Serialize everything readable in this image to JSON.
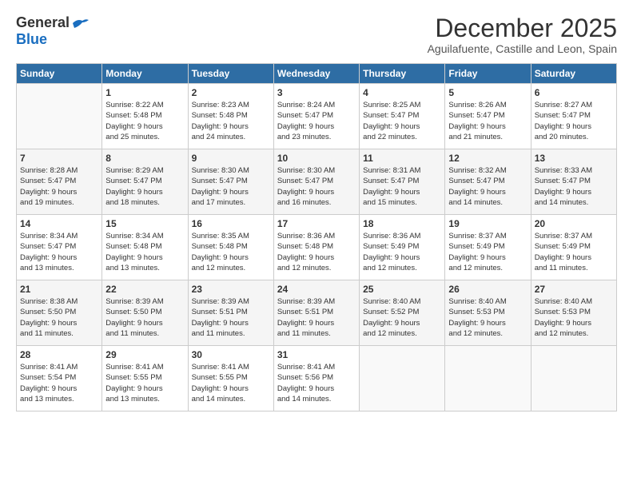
{
  "logo": {
    "general": "General",
    "blue": "Blue"
  },
  "title": "December 2025",
  "subtitle": "Aguilafuente, Castille and Leon, Spain",
  "weekdays": [
    "Sunday",
    "Monday",
    "Tuesday",
    "Wednesday",
    "Thursday",
    "Friday",
    "Saturday"
  ],
  "weeks": [
    [
      {
        "day": "",
        "info": ""
      },
      {
        "day": "1",
        "info": "Sunrise: 8:22 AM\nSunset: 5:48 PM\nDaylight: 9 hours\nand 25 minutes."
      },
      {
        "day": "2",
        "info": "Sunrise: 8:23 AM\nSunset: 5:48 PM\nDaylight: 9 hours\nand 24 minutes."
      },
      {
        "day": "3",
        "info": "Sunrise: 8:24 AM\nSunset: 5:47 PM\nDaylight: 9 hours\nand 23 minutes."
      },
      {
        "day": "4",
        "info": "Sunrise: 8:25 AM\nSunset: 5:47 PM\nDaylight: 9 hours\nand 22 minutes."
      },
      {
        "day": "5",
        "info": "Sunrise: 8:26 AM\nSunset: 5:47 PM\nDaylight: 9 hours\nand 21 minutes."
      },
      {
        "day": "6",
        "info": "Sunrise: 8:27 AM\nSunset: 5:47 PM\nDaylight: 9 hours\nand 20 minutes."
      }
    ],
    [
      {
        "day": "7",
        "info": "Sunrise: 8:28 AM\nSunset: 5:47 PM\nDaylight: 9 hours\nand 19 minutes."
      },
      {
        "day": "8",
        "info": "Sunrise: 8:29 AM\nSunset: 5:47 PM\nDaylight: 9 hours\nand 18 minutes."
      },
      {
        "day": "9",
        "info": "Sunrise: 8:30 AM\nSunset: 5:47 PM\nDaylight: 9 hours\nand 17 minutes."
      },
      {
        "day": "10",
        "info": "Sunrise: 8:30 AM\nSunset: 5:47 PM\nDaylight: 9 hours\nand 16 minutes."
      },
      {
        "day": "11",
        "info": "Sunrise: 8:31 AM\nSunset: 5:47 PM\nDaylight: 9 hours\nand 15 minutes."
      },
      {
        "day": "12",
        "info": "Sunrise: 8:32 AM\nSunset: 5:47 PM\nDaylight: 9 hours\nand 14 minutes."
      },
      {
        "day": "13",
        "info": "Sunrise: 8:33 AM\nSunset: 5:47 PM\nDaylight: 9 hours\nand 14 minutes."
      }
    ],
    [
      {
        "day": "14",
        "info": "Sunrise: 8:34 AM\nSunset: 5:47 PM\nDaylight: 9 hours\nand 13 minutes."
      },
      {
        "day": "15",
        "info": "Sunrise: 8:34 AM\nSunset: 5:48 PM\nDaylight: 9 hours\nand 13 minutes."
      },
      {
        "day": "16",
        "info": "Sunrise: 8:35 AM\nSunset: 5:48 PM\nDaylight: 9 hours\nand 12 minutes."
      },
      {
        "day": "17",
        "info": "Sunrise: 8:36 AM\nSunset: 5:48 PM\nDaylight: 9 hours\nand 12 minutes."
      },
      {
        "day": "18",
        "info": "Sunrise: 8:36 AM\nSunset: 5:49 PM\nDaylight: 9 hours\nand 12 minutes."
      },
      {
        "day": "19",
        "info": "Sunrise: 8:37 AM\nSunset: 5:49 PM\nDaylight: 9 hours\nand 12 minutes."
      },
      {
        "day": "20",
        "info": "Sunrise: 8:37 AM\nSunset: 5:49 PM\nDaylight: 9 hours\nand 11 minutes."
      }
    ],
    [
      {
        "day": "21",
        "info": "Sunrise: 8:38 AM\nSunset: 5:50 PM\nDaylight: 9 hours\nand 11 minutes."
      },
      {
        "day": "22",
        "info": "Sunrise: 8:39 AM\nSunset: 5:50 PM\nDaylight: 9 hours\nand 11 minutes."
      },
      {
        "day": "23",
        "info": "Sunrise: 8:39 AM\nSunset: 5:51 PM\nDaylight: 9 hours\nand 11 minutes."
      },
      {
        "day": "24",
        "info": "Sunrise: 8:39 AM\nSunset: 5:51 PM\nDaylight: 9 hours\nand 11 minutes."
      },
      {
        "day": "25",
        "info": "Sunrise: 8:40 AM\nSunset: 5:52 PM\nDaylight: 9 hours\nand 12 minutes."
      },
      {
        "day": "26",
        "info": "Sunrise: 8:40 AM\nSunset: 5:53 PM\nDaylight: 9 hours\nand 12 minutes."
      },
      {
        "day": "27",
        "info": "Sunrise: 8:40 AM\nSunset: 5:53 PM\nDaylight: 9 hours\nand 12 minutes."
      }
    ],
    [
      {
        "day": "28",
        "info": "Sunrise: 8:41 AM\nSunset: 5:54 PM\nDaylight: 9 hours\nand 13 minutes."
      },
      {
        "day": "29",
        "info": "Sunrise: 8:41 AM\nSunset: 5:55 PM\nDaylight: 9 hours\nand 13 minutes."
      },
      {
        "day": "30",
        "info": "Sunrise: 8:41 AM\nSunset: 5:55 PM\nDaylight: 9 hours\nand 14 minutes."
      },
      {
        "day": "31",
        "info": "Sunrise: 8:41 AM\nSunset: 5:56 PM\nDaylight: 9 hours\nand 14 minutes."
      },
      {
        "day": "",
        "info": ""
      },
      {
        "day": "",
        "info": ""
      },
      {
        "day": "",
        "info": ""
      }
    ]
  ]
}
